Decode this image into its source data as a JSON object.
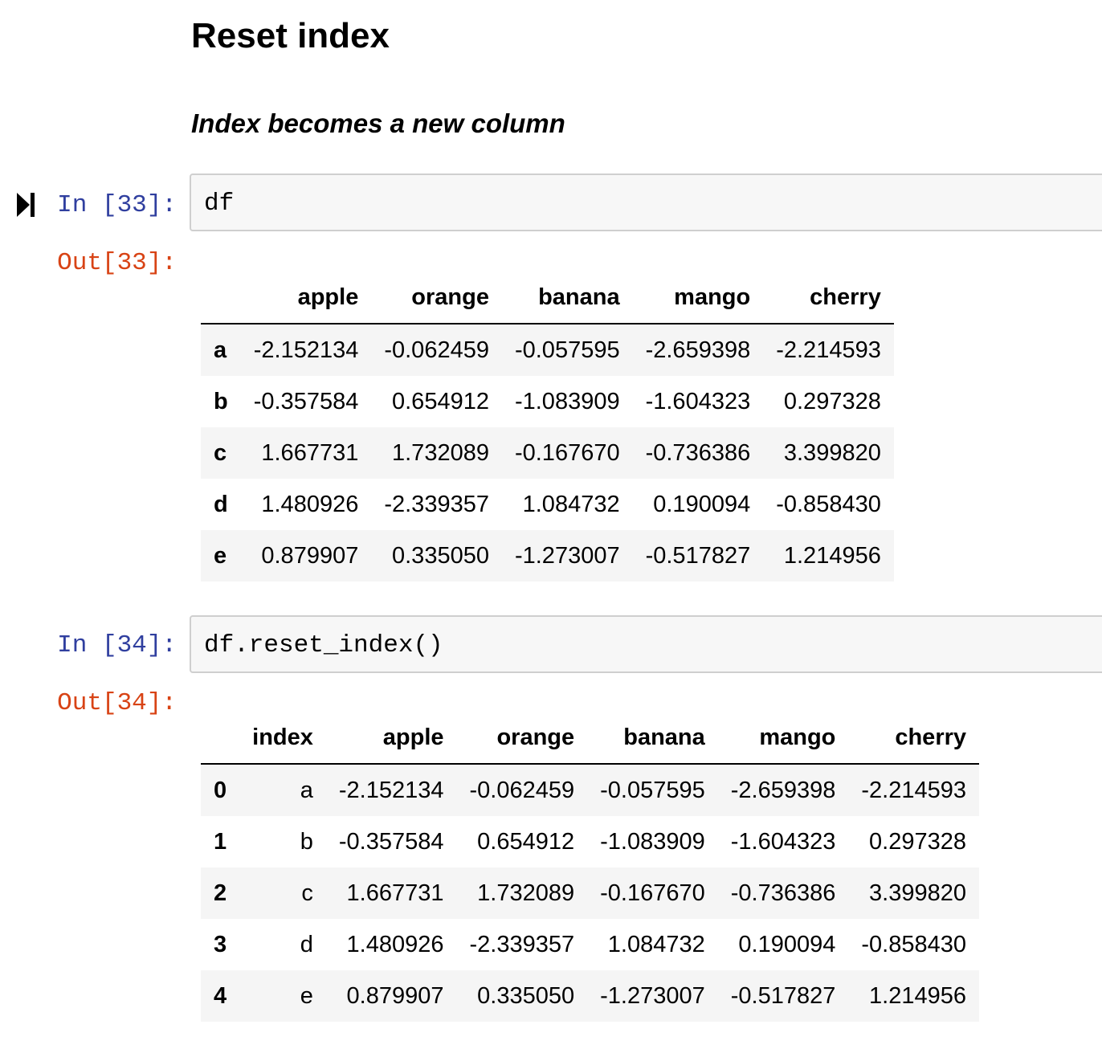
{
  "heading": "Reset index",
  "subheading": "Index becomes a new column",
  "cell1": {
    "in_prompt": "In [33]:",
    "code": "df",
    "out_prompt": "Out[33]:",
    "table": {
      "columns": [
        "",
        "apple",
        "orange",
        "banana",
        "mango",
        "cherry"
      ],
      "rows": [
        {
          "index": "a",
          "values": [
            "-2.152134",
            "-0.062459",
            "-0.057595",
            "-2.659398",
            "-2.214593"
          ]
        },
        {
          "index": "b",
          "values": [
            "-0.357584",
            "0.654912",
            "-1.083909",
            "-1.604323",
            "0.297328"
          ]
        },
        {
          "index": "c",
          "values": [
            "1.667731",
            "1.732089",
            "-0.167670",
            "-0.736386",
            "3.399820"
          ]
        },
        {
          "index": "d",
          "values": [
            "1.480926",
            "-2.339357",
            "1.084732",
            "0.190094",
            "-0.858430"
          ]
        },
        {
          "index": "e",
          "values": [
            "0.879907",
            "0.335050",
            "-1.273007",
            "-0.517827",
            "1.214956"
          ]
        }
      ]
    }
  },
  "cell2": {
    "in_prompt": "In [34]:",
    "code": "df.reset_index()",
    "out_prompt": "Out[34]:",
    "table": {
      "columns": [
        "",
        "index",
        "apple",
        "orange",
        "banana",
        "mango",
        "cherry"
      ],
      "rows": [
        {
          "index": "0",
          "values": [
            "a",
            "-2.152134",
            "-0.062459",
            "-0.057595",
            "-2.659398",
            "-2.214593"
          ]
        },
        {
          "index": "1",
          "values": [
            "b",
            "-0.357584",
            "0.654912",
            "-1.083909",
            "-1.604323",
            "0.297328"
          ]
        },
        {
          "index": "2",
          "values": [
            "c",
            "1.667731",
            "1.732089",
            "-0.167670",
            "-0.736386",
            "3.399820"
          ]
        },
        {
          "index": "3",
          "values": [
            "d",
            "1.480926",
            "-2.339357",
            "1.084732",
            "0.190094",
            "-0.858430"
          ]
        },
        {
          "index": "4",
          "values": [
            "e",
            "0.879907",
            "0.335050",
            "-1.273007",
            "-0.517827",
            "1.214956"
          ]
        }
      ]
    }
  },
  "icons": {
    "run_marker": "run-cursor-icon"
  },
  "colors": {
    "in_prompt": "#303f9f",
    "out_prompt": "#d84315",
    "input_bg": "#f7f7f7"
  }
}
